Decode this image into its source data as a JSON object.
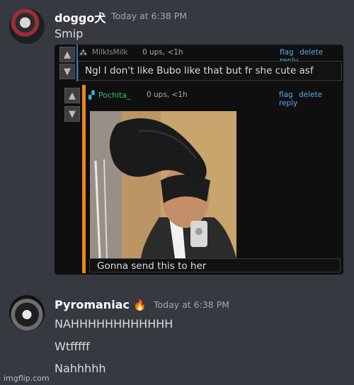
{
  "messages": [
    {
      "username": "doggo犬",
      "timestamp": "Today at 6:38 PM",
      "lines": [
        "Smip"
      ]
    },
    {
      "username": "Pyromaniac",
      "badge": "🔥",
      "timestamp": "Today at 6:38 PM",
      "lines": [
        "NAHHHHHHHHHHHH",
        "Wtfffff",
        "Nahhhhh"
      ]
    }
  ],
  "embed": {
    "comment1": {
      "icon": "⁂",
      "username": "MilkIsMilk",
      "meta": "0 ups, <1h",
      "text": "Ngl I don't like Bubo like that but fr she cute asf",
      "links": [
        "flag",
        "delete",
        "reply"
      ]
    },
    "comment2": {
      "icon": "▞",
      "username": "Pochita_",
      "meta": "0 ups, <1h",
      "caption": "Gonna send this to her",
      "links": [
        "flag",
        "delete",
        "reply"
      ]
    }
  },
  "watermark": "imgflip.com",
  "colors": {
    "background": "#36393f",
    "link": "#5ba8ea",
    "accent": "#e8881e"
  }
}
